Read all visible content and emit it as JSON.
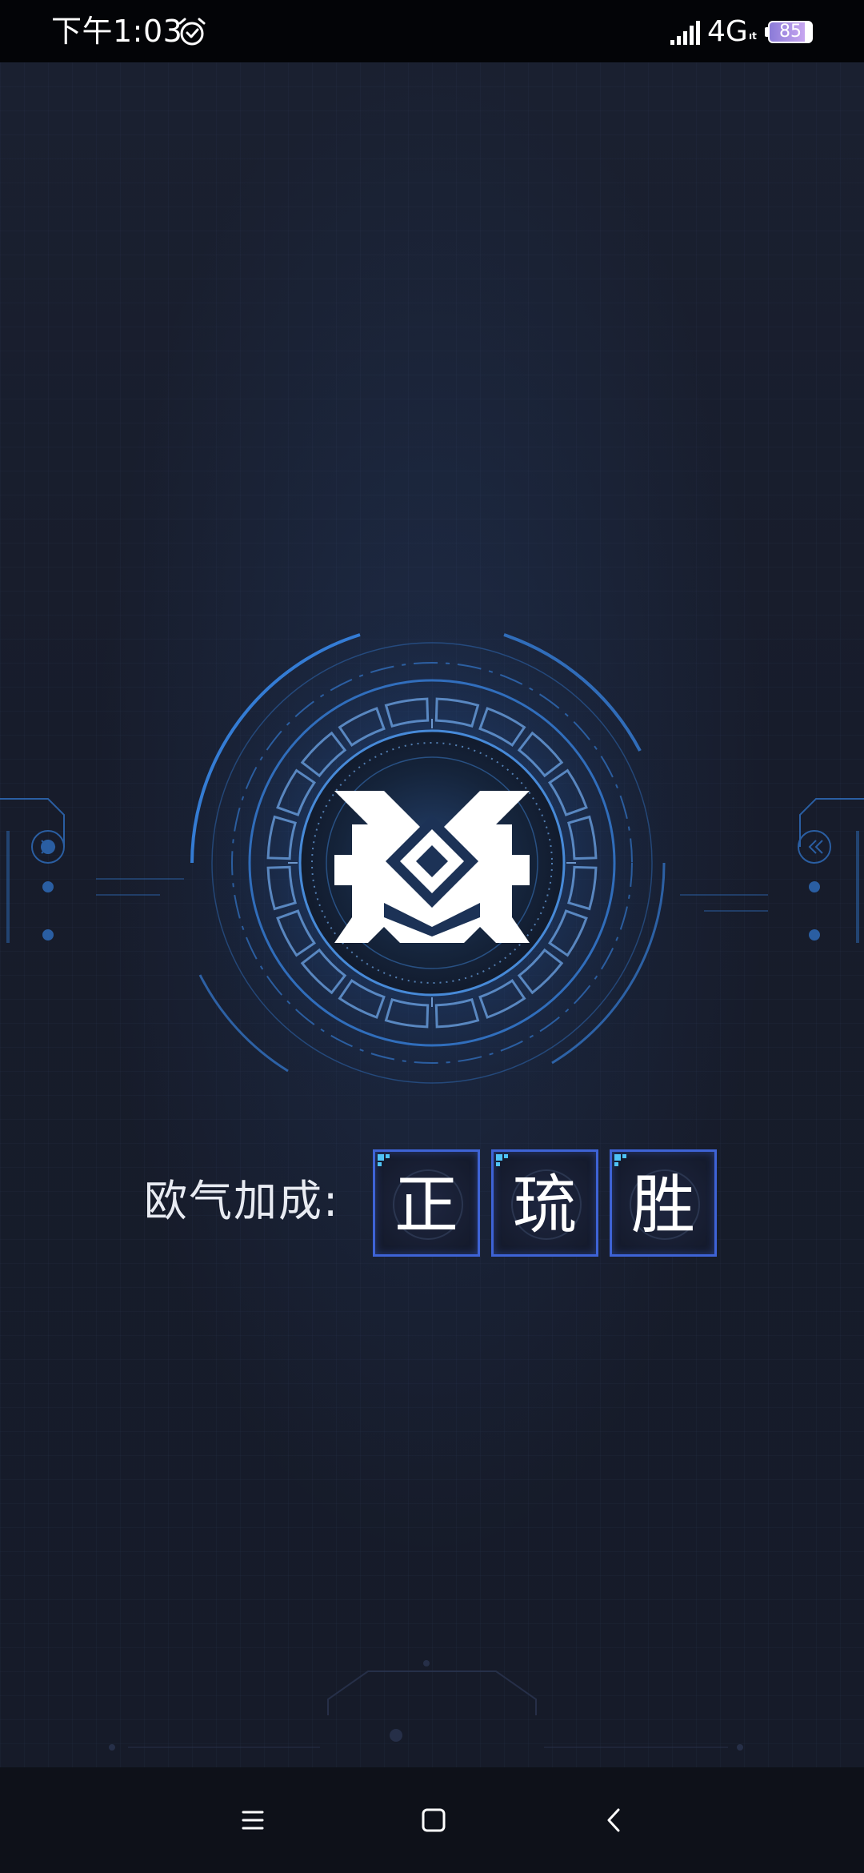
{
  "status_bar": {
    "time": "下午1:03",
    "network": "4G",
    "network_sub": "ıt",
    "battery_level": 85,
    "battery_text": "85",
    "icons": [
      "alarm-icon",
      "signal-icon",
      "battery-icon"
    ]
  },
  "splash": {
    "emblem_icon": "game-logo-emblem",
    "bonus_label": "欧气加成:",
    "name_chars": [
      "正",
      "琉",
      "胜"
    ]
  },
  "nav_bar": {
    "icons": [
      "menu-icon",
      "home-icon",
      "back-icon"
    ]
  },
  "colors": {
    "background": "#161b29",
    "accent_blue": "#3e63d6",
    "glow_blue": "#4aa3ff",
    "status_bar_bg": "#030407",
    "nav_bar_bg": "#0e1119",
    "battery_fill": "#8b7bd8"
  }
}
